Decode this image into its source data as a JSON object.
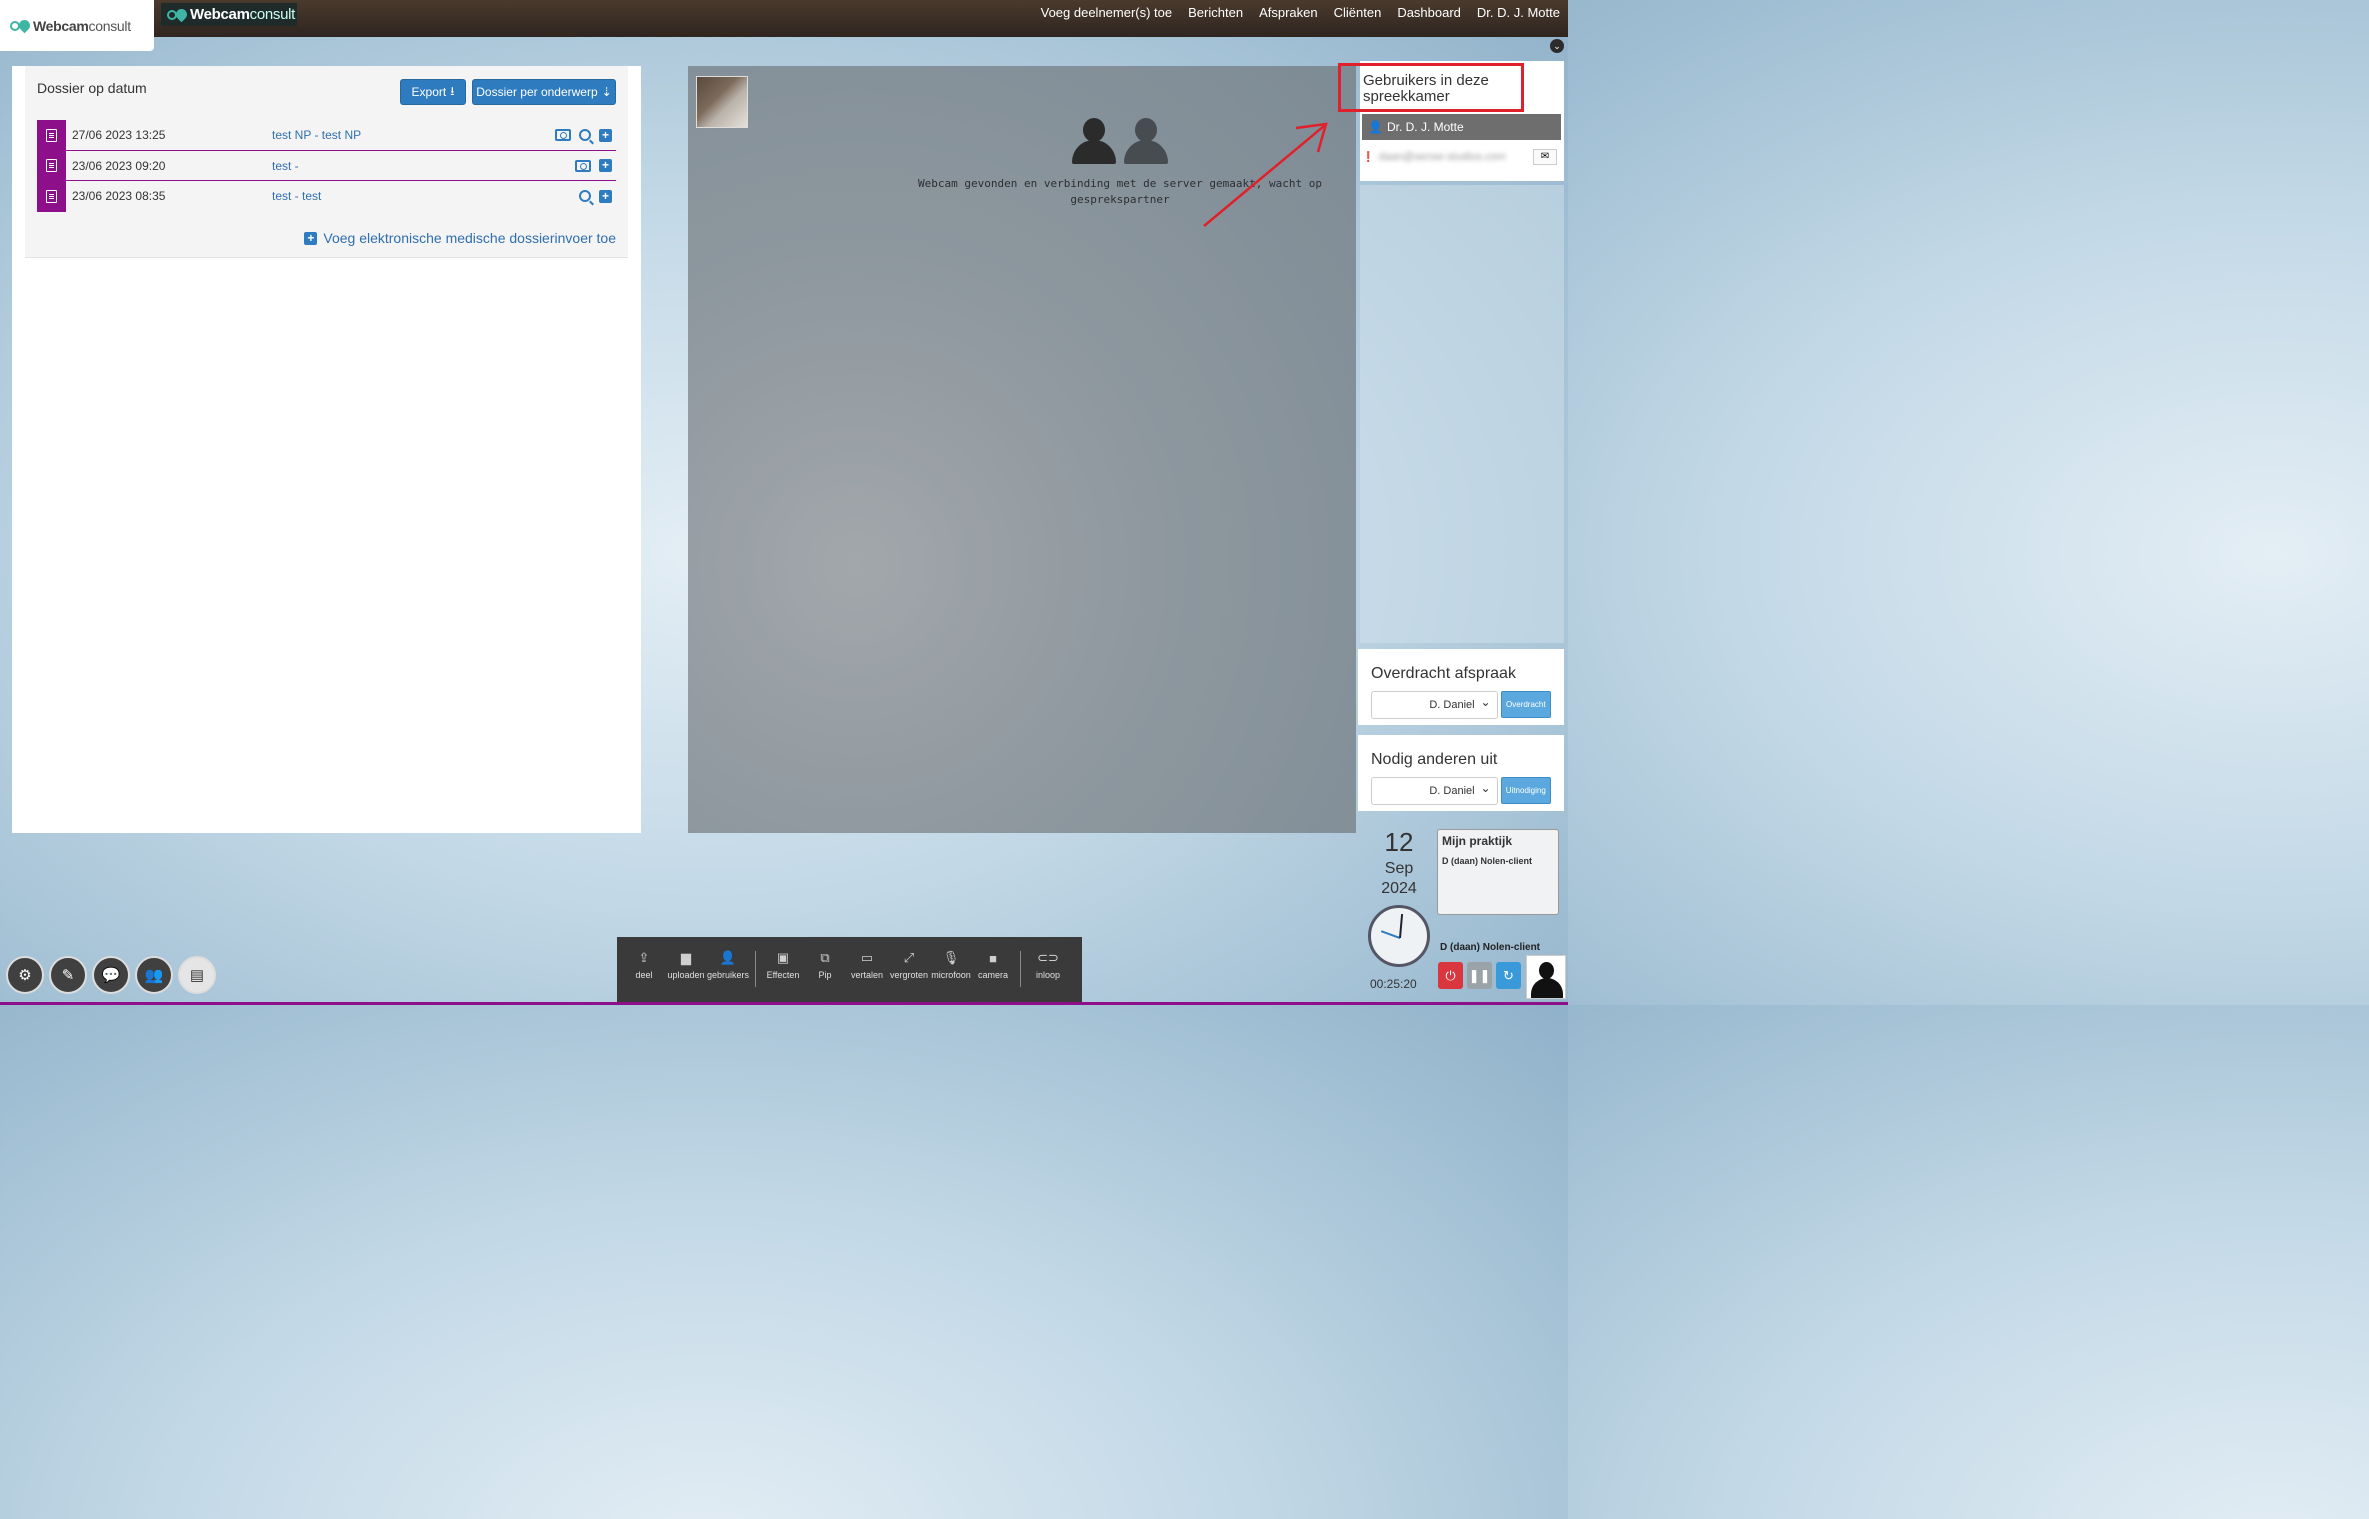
{
  "header": {
    "logo_text_strong": "Webcam",
    "logo_text_light": "consult",
    "nav": [
      "Voeg deelnemer(s) toe",
      "Berichten",
      "Afspraken",
      "Cliënten",
      "Dashboard",
      "Dr. D. J. Motte"
    ]
  },
  "dossier": {
    "title": "Dossier op datum",
    "export_label": "Export",
    "per_onderwerp_label": "Dossier per onderwerp",
    "rows": [
      {
        "date": "27/06 2023 13:25",
        "title": "test NP - test NP",
        "icons": [
          "camera",
          "search",
          "plus"
        ]
      },
      {
        "date": "23/06 2023 09:20",
        "title": "test -",
        "icons": [
          "camera",
          "plus"
        ]
      },
      {
        "date": "23/06 2023 08:35",
        "title": "test - test",
        "icons": [
          "search",
          "plus"
        ]
      }
    ],
    "add_entry_label": "Voeg elektronische medische dossierinvoer toe"
  },
  "video": {
    "message": "Webcam gevonden en verbinding met de server gemaakt, wacht op gesprekspartner"
  },
  "sidebar": {
    "users_title": "Gebruikers in deze spreekkamer",
    "user_name": "Dr. D. J. Motte",
    "user_email": "daan@sense-studios.com",
    "overdracht": {
      "title": "Overdracht afspraak",
      "selected": "D. Daniel",
      "button": "Overdracht"
    },
    "nodig": {
      "title": "Nodig anderen uit",
      "selected": "D. Daniel",
      "button": "Uitnodiging"
    },
    "date": {
      "day": "12",
      "month": "Sep",
      "year": "2024"
    },
    "praktijk": {
      "title": "Mijn praktijk",
      "client": "D (daan) Nolen-client"
    },
    "clock_time": "00:25:20",
    "client_name": "D (daan) Nolen-client"
  },
  "toolbar": {
    "items": [
      {
        "label": "deel",
        "icon": "upload-box-icon"
      },
      {
        "label": "uploaden",
        "icon": "folder-icon"
      },
      {
        "label": "gebruikers",
        "icon": "add-user-icon"
      },
      {
        "label": "Effecten",
        "icon": "image-icon"
      },
      {
        "label": "Pip",
        "icon": "pip-icon"
      },
      {
        "label": "vertalen",
        "icon": "captions-icon"
      },
      {
        "label": "vergroten",
        "icon": "expand-icon"
      },
      {
        "label": "microfoon",
        "icon": "microphone-icon"
      },
      {
        "label": "camera",
        "icon": "video-camera-icon"
      },
      {
        "label": "inloop",
        "icon": "toggle-icon"
      }
    ]
  },
  "colors": {
    "accent": "#2f7bbf",
    "dossier_tag": "#8e0f8a",
    "highlight": "#e0202b"
  }
}
